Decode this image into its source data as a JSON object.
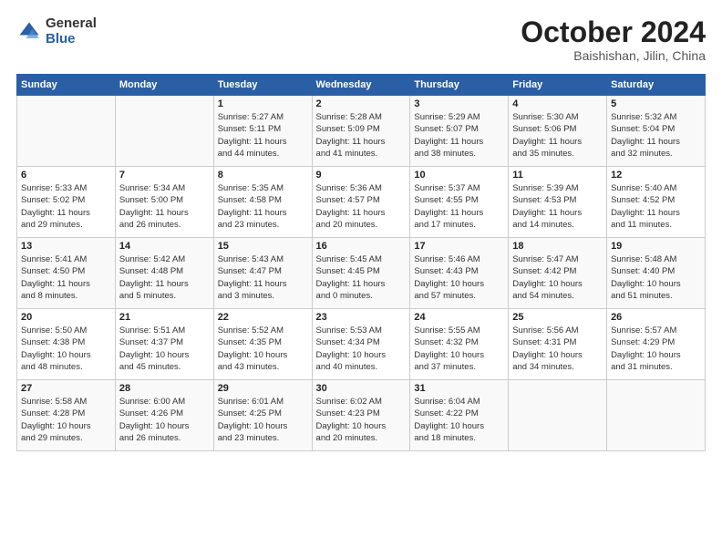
{
  "logo": {
    "general": "General",
    "blue": "Blue",
    "icon_color": "#2a5fa5"
  },
  "header": {
    "month": "October 2024",
    "location": "Baishishan, Jilin, China"
  },
  "weekdays": [
    "Sunday",
    "Monday",
    "Tuesday",
    "Wednesday",
    "Thursday",
    "Friday",
    "Saturday"
  ],
  "weeks": [
    [
      {
        "day": "",
        "info": ""
      },
      {
        "day": "",
        "info": ""
      },
      {
        "day": "1",
        "info": "Sunrise: 5:27 AM\nSunset: 5:11 PM\nDaylight: 11 hours\nand 44 minutes."
      },
      {
        "day": "2",
        "info": "Sunrise: 5:28 AM\nSunset: 5:09 PM\nDaylight: 11 hours\nand 41 minutes."
      },
      {
        "day": "3",
        "info": "Sunrise: 5:29 AM\nSunset: 5:07 PM\nDaylight: 11 hours\nand 38 minutes."
      },
      {
        "day": "4",
        "info": "Sunrise: 5:30 AM\nSunset: 5:06 PM\nDaylight: 11 hours\nand 35 minutes."
      },
      {
        "day": "5",
        "info": "Sunrise: 5:32 AM\nSunset: 5:04 PM\nDaylight: 11 hours\nand 32 minutes."
      }
    ],
    [
      {
        "day": "6",
        "info": "Sunrise: 5:33 AM\nSunset: 5:02 PM\nDaylight: 11 hours\nand 29 minutes."
      },
      {
        "day": "7",
        "info": "Sunrise: 5:34 AM\nSunset: 5:00 PM\nDaylight: 11 hours\nand 26 minutes."
      },
      {
        "day": "8",
        "info": "Sunrise: 5:35 AM\nSunset: 4:58 PM\nDaylight: 11 hours\nand 23 minutes."
      },
      {
        "day": "9",
        "info": "Sunrise: 5:36 AM\nSunset: 4:57 PM\nDaylight: 11 hours\nand 20 minutes."
      },
      {
        "day": "10",
        "info": "Sunrise: 5:37 AM\nSunset: 4:55 PM\nDaylight: 11 hours\nand 17 minutes."
      },
      {
        "day": "11",
        "info": "Sunrise: 5:39 AM\nSunset: 4:53 PM\nDaylight: 11 hours\nand 14 minutes."
      },
      {
        "day": "12",
        "info": "Sunrise: 5:40 AM\nSunset: 4:52 PM\nDaylight: 11 hours\nand 11 minutes."
      }
    ],
    [
      {
        "day": "13",
        "info": "Sunrise: 5:41 AM\nSunset: 4:50 PM\nDaylight: 11 hours\nand 8 minutes."
      },
      {
        "day": "14",
        "info": "Sunrise: 5:42 AM\nSunset: 4:48 PM\nDaylight: 11 hours\nand 5 minutes."
      },
      {
        "day": "15",
        "info": "Sunrise: 5:43 AM\nSunset: 4:47 PM\nDaylight: 11 hours\nand 3 minutes."
      },
      {
        "day": "16",
        "info": "Sunrise: 5:45 AM\nSunset: 4:45 PM\nDaylight: 11 hours\nand 0 minutes."
      },
      {
        "day": "17",
        "info": "Sunrise: 5:46 AM\nSunset: 4:43 PM\nDaylight: 10 hours\nand 57 minutes."
      },
      {
        "day": "18",
        "info": "Sunrise: 5:47 AM\nSunset: 4:42 PM\nDaylight: 10 hours\nand 54 minutes."
      },
      {
        "day": "19",
        "info": "Sunrise: 5:48 AM\nSunset: 4:40 PM\nDaylight: 10 hours\nand 51 minutes."
      }
    ],
    [
      {
        "day": "20",
        "info": "Sunrise: 5:50 AM\nSunset: 4:38 PM\nDaylight: 10 hours\nand 48 minutes."
      },
      {
        "day": "21",
        "info": "Sunrise: 5:51 AM\nSunset: 4:37 PM\nDaylight: 10 hours\nand 45 minutes."
      },
      {
        "day": "22",
        "info": "Sunrise: 5:52 AM\nSunset: 4:35 PM\nDaylight: 10 hours\nand 43 minutes."
      },
      {
        "day": "23",
        "info": "Sunrise: 5:53 AM\nSunset: 4:34 PM\nDaylight: 10 hours\nand 40 minutes."
      },
      {
        "day": "24",
        "info": "Sunrise: 5:55 AM\nSunset: 4:32 PM\nDaylight: 10 hours\nand 37 minutes."
      },
      {
        "day": "25",
        "info": "Sunrise: 5:56 AM\nSunset: 4:31 PM\nDaylight: 10 hours\nand 34 minutes."
      },
      {
        "day": "26",
        "info": "Sunrise: 5:57 AM\nSunset: 4:29 PM\nDaylight: 10 hours\nand 31 minutes."
      }
    ],
    [
      {
        "day": "27",
        "info": "Sunrise: 5:58 AM\nSunset: 4:28 PM\nDaylight: 10 hours\nand 29 minutes."
      },
      {
        "day": "28",
        "info": "Sunrise: 6:00 AM\nSunset: 4:26 PM\nDaylight: 10 hours\nand 26 minutes."
      },
      {
        "day": "29",
        "info": "Sunrise: 6:01 AM\nSunset: 4:25 PM\nDaylight: 10 hours\nand 23 minutes."
      },
      {
        "day": "30",
        "info": "Sunrise: 6:02 AM\nSunset: 4:23 PM\nDaylight: 10 hours\nand 20 minutes."
      },
      {
        "day": "31",
        "info": "Sunrise: 6:04 AM\nSunset: 4:22 PM\nDaylight: 10 hours\nand 18 minutes."
      },
      {
        "day": "",
        "info": ""
      },
      {
        "day": "",
        "info": ""
      }
    ]
  ]
}
